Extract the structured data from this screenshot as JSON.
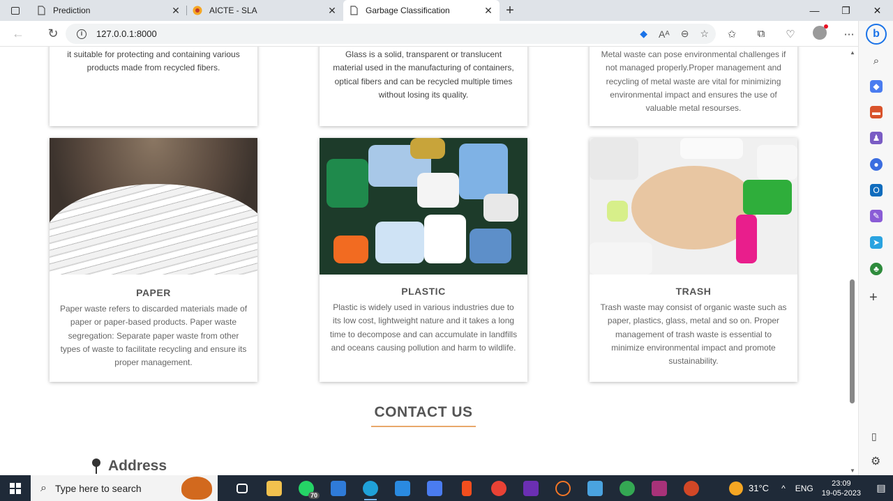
{
  "browser": {
    "tabs": [
      {
        "label": "Prediction",
        "active": false
      },
      {
        "label": "AICTE - SLA",
        "active": false
      },
      {
        "label": "Garbage Classification",
        "active": true
      }
    ],
    "url": "127.0.0.1:8000"
  },
  "cards_top": [
    {
      "text": "it suitable for protecting and containing various products made from recycled fibers."
    },
    {
      "text": "Glass is a solid, transparent or translucent material used in the manufacturing of containers, optical fibers and can be recycled multiple times without losing its quality."
    },
    {
      "text": "Metal waste can pose environmental challenges if not managed properly.Proper management and recycling of metal waste are vital for minimizing environmental impact and ensures the use of valuable metal resourses."
    }
  ],
  "cards": [
    {
      "title": "PAPER",
      "text": "Paper waste refers to discarded materials made of paper or paper-based products. Paper waste segregation: Separate paper waste from other types of waste to facilitate recycling and ensure its proper management."
    },
    {
      "title": "PLASTIC",
      "text": "Plastic is widely used in various industries due to its low cost, lightweight nature and it takes a long time to decompose and can accumulate in landfills and oceans causing pollution and harm to wildlife."
    },
    {
      "title": "TRASH",
      "text": "Trash waste may consist of organic waste such as paper, plastics, glass, metal and so on. Proper management of trash waste is essential to minimize environmental impact and promote sustainability."
    }
  ],
  "contact": {
    "heading": "CONTACT US",
    "address_label": "Address"
  },
  "taskbar": {
    "search_placeholder": "Type here to search",
    "whatsapp_badge": "70",
    "temperature": "31°C",
    "language": "ENG",
    "time": "23:09",
    "date": "19-05-2023"
  },
  "colors": {
    "accent_line": "#e8a86a",
    "taskbar": "#1f2a38"
  }
}
